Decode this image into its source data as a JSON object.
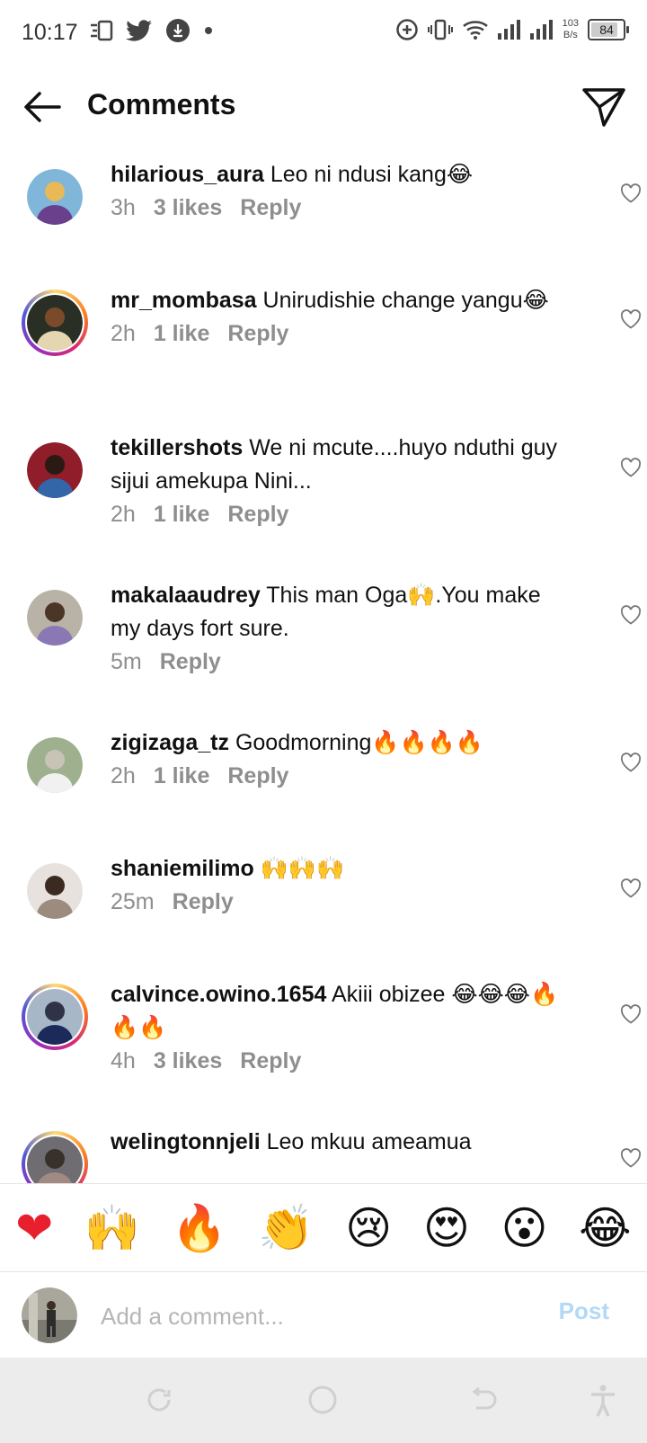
{
  "status_bar": {
    "time": "10:17",
    "net_speed_top": "103",
    "net_speed_bottom": "B/s",
    "battery": "84",
    "battery_level": 0.84
  },
  "header": {
    "title": "Comments"
  },
  "comments": [
    {
      "username": "hilarious_aura",
      "text": "Leo ni ndusi kang😂",
      "time": "3h",
      "likes": "3 likes",
      "reply": "Reply"
    },
    {
      "username": "mr_mombasa",
      "text": "Unirudishie change yangu😂",
      "time": "2h",
      "likes": "1 like",
      "reply": "Reply"
    },
    {
      "username": "tekillershots",
      "text": "We ni mcute....huyo nduthi guy sijui amekupa Nini...",
      "time": "2h",
      "likes": "1 like",
      "reply": "Reply"
    },
    {
      "username": "makalaaudrey",
      "text": "This man Oga🙌.You make my days fort sure.",
      "time": "5m",
      "likes": "",
      "reply": "Reply"
    },
    {
      "username": "zigizaga_tz",
      "text": "Goodmorning🔥🔥🔥🔥",
      "time": "2h",
      "likes": "1 like",
      "reply": "Reply"
    },
    {
      "username": "shaniemilimo",
      "text": "🙌🙌🙌",
      "time": "25m",
      "likes": "",
      "reply": "Reply"
    },
    {
      "username": "calvince.owino.1654",
      "text": "Akiii obizee 😂😂😂🔥🔥🔥",
      "time": "4h",
      "likes": "3 likes",
      "reply": "Reply"
    },
    {
      "username": "welingtonnjeli",
      "text": "Leo mkuu ameamua",
      "time": "",
      "likes": "",
      "reply": ""
    }
  ],
  "emoji_bar": [
    "❤",
    "🙌",
    "🔥",
    "👏",
    "😢",
    "😍",
    "😮",
    "😂"
  ],
  "composer": {
    "placeholder": "Add a comment...",
    "post_label": "Post"
  },
  "colors": {
    "meta_gray": "#8e8e8e",
    "post_disabled": "#b3d9f7",
    "nav_bg": "#ececec"
  },
  "icons": {
    "back": "arrow-left-icon",
    "send": "paper-plane-icon",
    "like": "heart-outline-icon",
    "nav": [
      "recent-apps-icon",
      "home-icon",
      "back-icon",
      "accessibility-icon"
    ]
  }
}
